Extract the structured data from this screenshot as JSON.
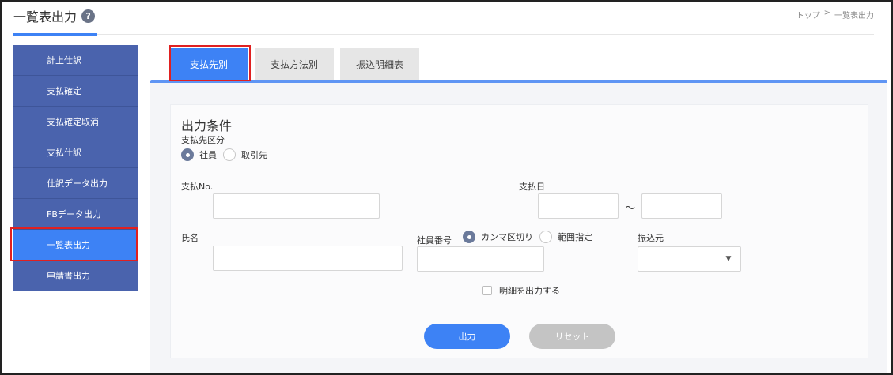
{
  "header": {
    "title": "一覧表出力",
    "help_icon": "?",
    "breadcrumb": {
      "home": "トップ",
      "separator": ">",
      "current": "一覧表出力"
    }
  },
  "sidebar": {
    "items": [
      {
        "label": "計上仕訳"
      },
      {
        "label": "支払確定"
      },
      {
        "label": "支払確定取消"
      },
      {
        "label": "支払仕訳"
      },
      {
        "label": "仕訳データ出力"
      },
      {
        "label": "FBデータ出力"
      },
      {
        "label": "一覧表出力",
        "active": true
      },
      {
        "label": "申請書出力"
      }
    ]
  },
  "tabs": [
    {
      "label": "支払先別",
      "active": true
    },
    {
      "label": "支払方法別"
    },
    {
      "label": "振込明細表"
    }
  ],
  "form": {
    "section_title": "出力条件",
    "payee_type": {
      "label": "支払先区分",
      "options": [
        {
          "label": "社員",
          "selected": true
        },
        {
          "label": "取引先"
        }
      ]
    },
    "payment_no": {
      "label": "支払No.",
      "value": ""
    },
    "payment_date": {
      "label": "支払日",
      "from": "",
      "to": "",
      "separator": "～"
    },
    "name": {
      "label": "氏名",
      "value": ""
    },
    "employee_no": {
      "label": "社員番号",
      "options": [
        {
          "label": "カンマ区切り",
          "selected": true
        },
        {
          "label": "範囲指定"
        }
      ],
      "value": ""
    },
    "transfer_source": {
      "label": "振込元",
      "value": ""
    },
    "detail_check": {
      "label": "明細を出力する",
      "checked": false
    },
    "buttons": {
      "output": "出力",
      "reset": "リセット"
    }
  },
  "colors": {
    "accent": "#3d82f5",
    "sidebar": "#4a63ad",
    "highlight": "#e02020"
  }
}
